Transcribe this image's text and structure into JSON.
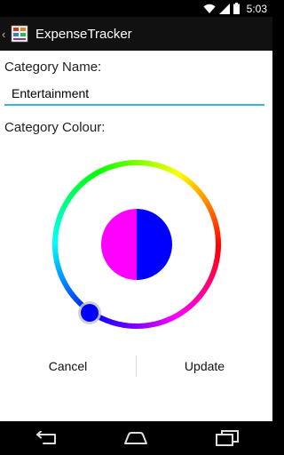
{
  "status_bar": {
    "time": "5:03"
  },
  "action_bar": {
    "up_caret": "‹",
    "title": "ExpenseTracker"
  },
  "form": {
    "name_label": "Category Name:",
    "name_value": "Entertainment",
    "colour_label": "Category Colour:"
  },
  "colour_picker": {
    "old_color": "#ff00ff",
    "new_color": "#0000ff",
    "selector_color": "#0000ff"
  },
  "buttons": {
    "cancel": "Cancel",
    "update": "Update"
  },
  "icons": {
    "wifi": "wifi-icon",
    "signal": "signal-icon",
    "battery": "battery-icon",
    "app": "app-icon",
    "back": "back-icon",
    "home": "home-icon",
    "recents": "recents-icon"
  }
}
